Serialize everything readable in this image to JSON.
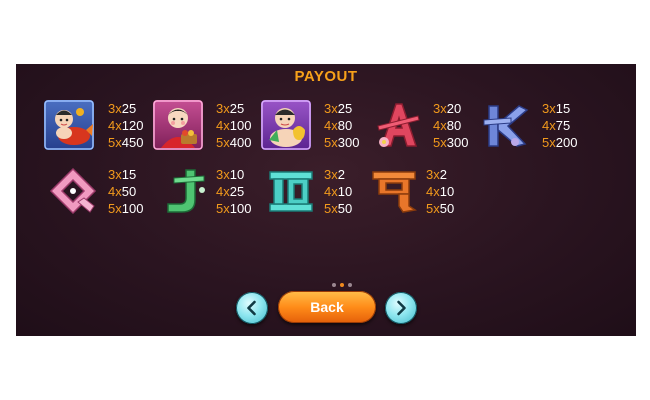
{
  "title": "PAYOUT",
  "symbols": [
    {
      "icon": "boy-with-fish-icon",
      "pays": [
        {
          "m": "3x",
          "v": "25"
        },
        {
          "m": "4x",
          "v": "120"
        },
        {
          "m": "5x",
          "v": "450"
        }
      ]
    },
    {
      "icon": "girl-with-basket-icon",
      "pays": [
        {
          "m": "3x",
          "v": "25"
        },
        {
          "m": "4x",
          "v": "100"
        },
        {
          "m": "5x",
          "v": "400"
        }
      ]
    },
    {
      "icon": "child-with-pear-icon",
      "pays": [
        {
          "m": "3x",
          "v": "25"
        },
        {
          "m": "4x",
          "v": "80"
        },
        {
          "m": "5x",
          "v": "300"
        }
      ]
    },
    {
      "icon": "letter-a-icon",
      "pays": [
        {
          "m": "3x",
          "v": "20"
        },
        {
          "m": "4x",
          "v": "80"
        },
        {
          "m": "5x",
          "v": "300"
        }
      ]
    },
    {
      "icon": "letter-k-icon",
      "pays": [
        {
          "m": "3x",
          "v": "15"
        },
        {
          "m": "4x",
          "v": "75"
        },
        {
          "m": "5x",
          "v": "200"
        }
      ]
    },
    {
      "icon": "letter-q-icon",
      "pays": [
        {
          "m": "3x",
          "v": "15"
        },
        {
          "m": "4x",
          "v": "50"
        },
        {
          "m": "5x",
          "v": "100"
        }
      ]
    },
    {
      "icon": "letter-j-icon",
      "pays": [
        {
          "m": "3x",
          "v": "10"
        },
        {
          "m": "4x",
          "v": "25"
        },
        {
          "m": "5x",
          "v": "100"
        }
      ]
    },
    {
      "icon": "number-10-icon",
      "pays": [
        {
          "m": "3x",
          "v": "2"
        },
        {
          "m": "4x",
          "v": "10"
        },
        {
          "m": "5x",
          "v": "50"
        }
      ]
    },
    {
      "icon": "number-9-icon",
      "pays": [
        {
          "m": "3x",
          "v": "2"
        },
        {
          "m": "4x",
          "v": "10"
        },
        {
          "m": "5x",
          "v": "50"
        }
      ]
    }
  ],
  "pagination": {
    "pages": 3,
    "current": 2
  },
  "buttons": {
    "back_label": "Back",
    "prev_icon": "chevron-left-icon",
    "next_icon": "chevron-right-icon"
  },
  "colors": {
    "title": "#f7a11a",
    "multiplier": "#f29a1c",
    "value": "#ffffff",
    "back_button": "#ff8c19",
    "nav_button": "#8de6ef",
    "background": "#2a1420"
  }
}
